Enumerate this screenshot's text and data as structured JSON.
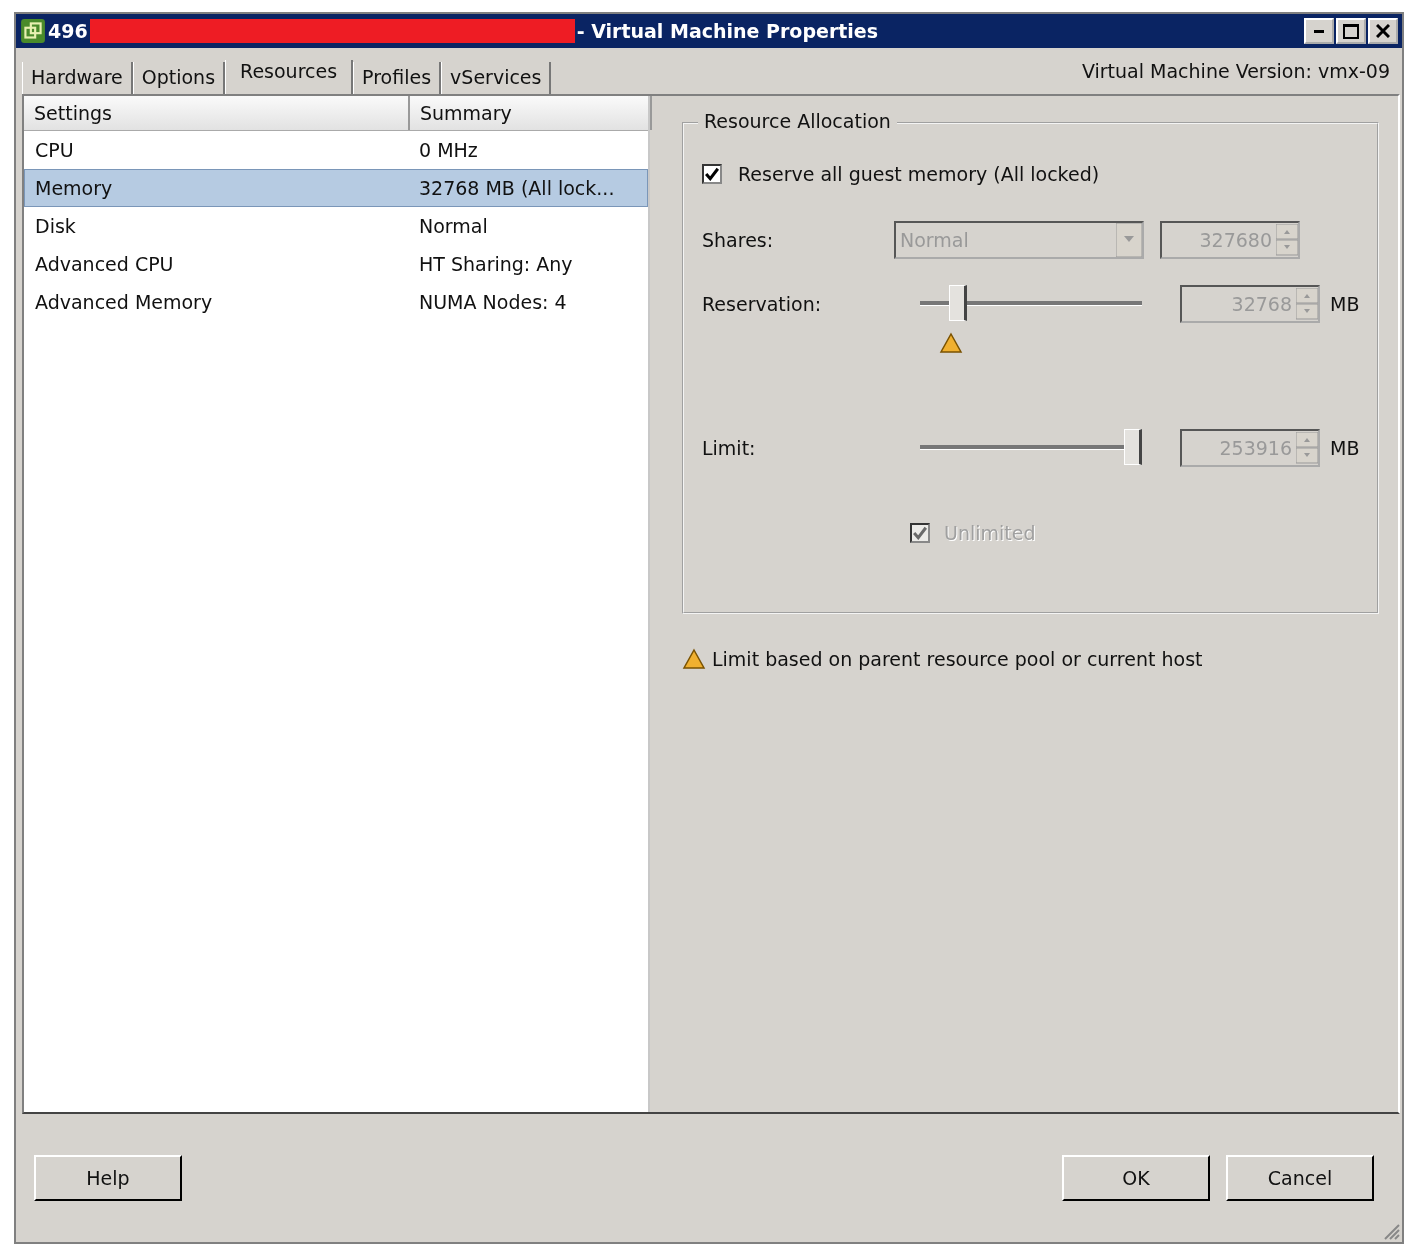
{
  "window": {
    "title_prefix": "496",
    "redacted": true,
    "title_suffix": "- Virtual Machine Properties"
  },
  "tabs": [
    {
      "label": "Hardware",
      "selected": false
    },
    {
      "label": "Options",
      "selected": false
    },
    {
      "label": "Resources",
      "selected": true
    },
    {
      "label": "Profiles",
      "selected": false
    },
    {
      "label": "vServices",
      "selected": false
    }
  ],
  "version_label": "Virtual Machine Version: vmx-09",
  "settings_table": {
    "columns": [
      "Settings",
      "Summary"
    ],
    "rows": [
      {
        "setting": "CPU",
        "summary": "0 MHz",
        "selected": false
      },
      {
        "setting": "Memory",
        "summary": "32768 MB (All lock...",
        "selected": true
      },
      {
        "setting": "Disk",
        "summary": "Normal",
        "selected": false
      },
      {
        "setting": "Advanced CPU",
        "summary": "HT Sharing: Any",
        "selected": false
      },
      {
        "setting": "Advanced Memory",
        "summary": "NUMA Nodes: 4",
        "selected": false
      }
    ]
  },
  "resource_allocation": {
    "title": "Resource Allocation",
    "reserve_all": {
      "label": "Reserve all guest memory (All locked)",
      "checked": true
    },
    "shares": {
      "label": "Shares:",
      "value": "Normal",
      "number": "327680",
      "disabled": true
    },
    "reservation": {
      "label": "Reservation:",
      "level": 0.17,
      "value": "32768",
      "unit": "MB",
      "warning": true,
      "disabled": true
    },
    "limit": {
      "label": "Limit:",
      "level": 0.96,
      "value": "253916",
      "unit": "MB",
      "disabled": true
    },
    "unlimited": {
      "label": "Unlimited",
      "checked": true,
      "disabled": true
    }
  },
  "note": "Limit based on parent resource pool or current host",
  "buttons": {
    "left": [
      "Help"
    ],
    "right": [
      "OK",
      "Cancel"
    ]
  }
}
